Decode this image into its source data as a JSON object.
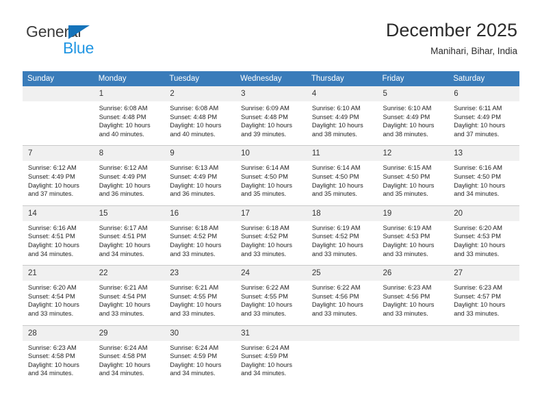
{
  "brand": {
    "name_part1": "General",
    "name_part2": "Blue",
    "triangle_color": "#1573ba",
    "blue_color": "#2196e3"
  },
  "header": {
    "title": "December 2025",
    "subtitle": "Manihari, Bihar, India",
    "header_bg": "#3a7cba"
  },
  "weekday_headers": [
    "Sunday",
    "Monday",
    "Tuesday",
    "Wednesday",
    "Thursday",
    "Friday",
    "Saturday"
  ],
  "weeks": [
    [
      {
        "day": "",
        "empty": true,
        "sunrise": "",
        "sunset": "",
        "daylight_line1": "",
        "daylight_line2": ""
      },
      {
        "day": "1",
        "sunrise": "Sunrise: 6:08 AM",
        "sunset": "Sunset: 4:48 PM",
        "daylight_line1": "Daylight: 10 hours",
        "daylight_line2": "and 40 minutes."
      },
      {
        "day": "2",
        "sunrise": "Sunrise: 6:08 AM",
        "sunset": "Sunset: 4:48 PM",
        "daylight_line1": "Daylight: 10 hours",
        "daylight_line2": "and 40 minutes."
      },
      {
        "day": "3",
        "sunrise": "Sunrise: 6:09 AM",
        "sunset": "Sunset: 4:48 PM",
        "daylight_line1": "Daylight: 10 hours",
        "daylight_line2": "and 39 minutes."
      },
      {
        "day": "4",
        "sunrise": "Sunrise: 6:10 AM",
        "sunset": "Sunset: 4:49 PM",
        "daylight_line1": "Daylight: 10 hours",
        "daylight_line2": "and 38 minutes."
      },
      {
        "day": "5",
        "sunrise": "Sunrise: 6:10 AM",
        "sunset": "Sunset: 4:49 PM",
        "daylight_line1": "Daylight: 10 hours",
        "daylight_line2": "and 38 minutes."
      },
      {
        "day": "6",
        "sunrise": "Sunrise: 6:11 AM",
        "sunset": "Sunset: 4:49 PM",
        "daylight_line1": "Daylight: 10 hours",
        "daylight_line2": "and 37 minutes."
      }
    ],
    [
      {
        "day": "7",
        "sunrise": "Sunrise: 6:12 AM",
        "sunset": "Sunset: 4:49 PM",
        "daylight_line1": "Daylight: 10 hours",
        "daylight_line2": "and 37 minutes."
      },
      {
        "day": "8",
        "sunrise": "Sunrise: 6:12 AM",
        "sunset": "Sunset: 4:49 PM",
        "daylight_line1": "Daylight: 10 hours",
        "daylight_line2": "and 36 minutes."
      },
      {
        "day": "9",
        "sunrise": "Sunrise: 6:13 AM",
        "sunset": "Sunset: 4:49 PM",
        "daylight_line1": "Daylight: 10 hours",
        "daylight_line2": "and 36 minutes."
      },
      {
        "day": "10",
        "sunrise": "Sunrise: 6:14 AM",
        "sunset": "Sunset: 4:50 PM",
        "daylight_line1": "Daylight: 10 hours",
        "daylight_line2": "and 35 minutes."
      },
      {
        "day": "11",
        "sunrise": "Sunrise: 6:14 AM",
        "sunset": "Sunset: 4:50 PM",
        "daylight_line1": "Daylight: 10 hours",
        "daylight_line2": "and 35 minutes."
      },
      {
        "day": "12",
        "sunrise": "Sunrise: 6:15 AM",
        "sunset": "Sunset: 4:50 PM",
        "daylight_line1": "Daylight: 10 hours",
        "daylight_line2": "and 35 minutes."
      },
      {
        "day": "13",
        "sunrise": "Sunrise: 6:16 AM",
        "sunset": "Sunset: 4:50 PM",
        "daylight_line1": "Daylight: 10 hours",
        "daylight_line2": "and 34 minutes."
      }
    ],
    [
      {
        "day": "14",
        "sunrise": "Sunrise: 6:16 AM",
        "sunset": "Sunset: 4:51 PM",
        "daylight_line1": "Daylight: 10 hours",
        "daylight_line2": "and 34 minutes."
      },
      {
        "day": "15",
        "sunrise": "Sunrise: 6:17 AM",
        "sunset": "Sunset: 4:51 PM",
        "daylight_line1": "Daylight: 10 hours",
        "daylight_line2": "and 34 minutes."
      },
      {
        "day": "16",
        "sunrise": "Sunrise: 6:18 AM",
        "sunset": "Sunset: 4:52 PM",
        "daylight_line1": "Daylight: 10 hours",
        "daylight_line2": "and 33 minutes."
      },
      {
        "day": "17",
        "sunrise": "Sunrise: 6:18 AM",
        "sunset": "Sunset: 4:52 PM",
        "daylight_line1": "Daylight: 10 hours",
        "daylight_line2": "and 33 minutes."
      },
      {
        "day": "18",
        "sunrise": "Sunrise: 6:19 AM",
        "sunset": "Sunset: 4:52 PM",
        "daylight_line1": "Daylight: 10 hours",
        "daylight_line2": "and 33 minutes."
      },
      {
        "day": "19",
        "sunrise": "Sunrise: 6:19 AM",
        "sunset": "Sunset: 4:53 PM",
        "daylight_line1": "Daylight: 10 hours",
        "daylight_line2": "and 33 minutes."
      },
      {
        "day": "20",
        "sunrise": "Sunrise: 6:20 AM",
        "sunset": "Sunset: 4:53 PM",
        "daylight_line1": "Daylight: 10 hours",
        "daylight_line2": "and 33 minutes."
      }
    ],
    [
      {
        "day": "21",
        "sunrise": "Sunrise: 6:20 AM",
        "sunset": "Sunset: 4:54 PM",
        "daylight_line1": "Daylight: 10 hours",
        "daylight_line2": "and 33 minutes."
      },
      {
        "day": "22",
        "sunrise": "Sunrise: 6:21 AM",
        "sunset": "Sunset: 4:54 PM",
        "daylight_line1": "Daylight: 10 hours",
        "daylight_line2": "and 33 minutes."
      },
      {
        "day": "23",
        "sunrise": "Sunrise: 6:21 AM",
        "sunset": "Sunset: 4:55 PM",
        "daylight_line1": "Daylight: 10 hours",
        "daylight_line2": "and 33 minutes."
      },
      {
        "day": "24",
        "sunrise": "Sunrise: 6:22 AM",
        "sunset": "Sunset: 4:55 PM",
        "daylight_line1": "Daylight: 10 hours",
        "daylight_line2": "and 33 minutes."
      },
      {
        "day": "25",
        "sunrise": "Sunrise: 6:22 AM",
        "sunset": "Sunset: 4:56 PM",
        "daylight_line1": "Daylight: 10 hours",
        "daylight_line2": "and 33 minutes."
      },
      {
        "day": "26",
        "sunrise": "Sunrise: 6:23 AM",
        "sunset": "Sunset: 4:56 PM",
        "daylight_line1": "Daylight: 10 hours",
        "daylight_line2": "and 33 minutes."
      },
      {
        "day": "27",
        "sunrise": "Sunrise: 6:23 AM",
        "sunset": "Sunset: 4:57 PM",
        "daylight_line1": "Daylight: 10 hours",
        "daylight_line2": "and 33 minutes."
      }
    ],
    [
      {
        "day": "28",
        "sunrise": "Sunrise: 6:23 AM",
        "sunset": "Sunset: 4:58 PM",
        "daylight_line1": "Daylight: 10 hours",
        "daylight_line2": "and 34 minutes."
      },
      {
        "day": "29",
        "sunrise": "Sunrise: 6:24 AM",
        "sunset": "Sunset: 4:58 PM",
        "daylight_line1": "Daylight: 10 hours",
        "daylight_line2": "and 34 minutes."
      },
      {
        "day": "30",
        "sunrise": "Sunrise: 6:24 AM",
        "sunset": "Sunset: 4:59 PM",
        "daylight_line1": "Daylight: 10 hours",
        "daylight_line2": "and 34 minutes."
      },
      {
        "day": "31",
        "sunrise": "Sunrise: 6:24 AM",
        "sunset": "Sunset: 4:59 PM",
        "daylight_line1": "Daylight: 10 hours",
        "daylight_line2": "and 34 minutes."
      },
      {
        "day": "",
        "empty": true,
        "sunrise": "",
        "sunset": "",
        "daylight_line1": "",
        "daylight_line2": ""
      },
      {
        "day": "",
        "empty": true,
        "sunrise": "",
        "sunset": "",
        "daylight_line1": "",
        "daylight_line2": ""
      },
      {
        "day": "",
        "empty": true,
        "sunrise": "",
        "sunset": "",
        "daylight_line1": "",
        "daylight_line2": ""
      }
    ]
  ]
}
